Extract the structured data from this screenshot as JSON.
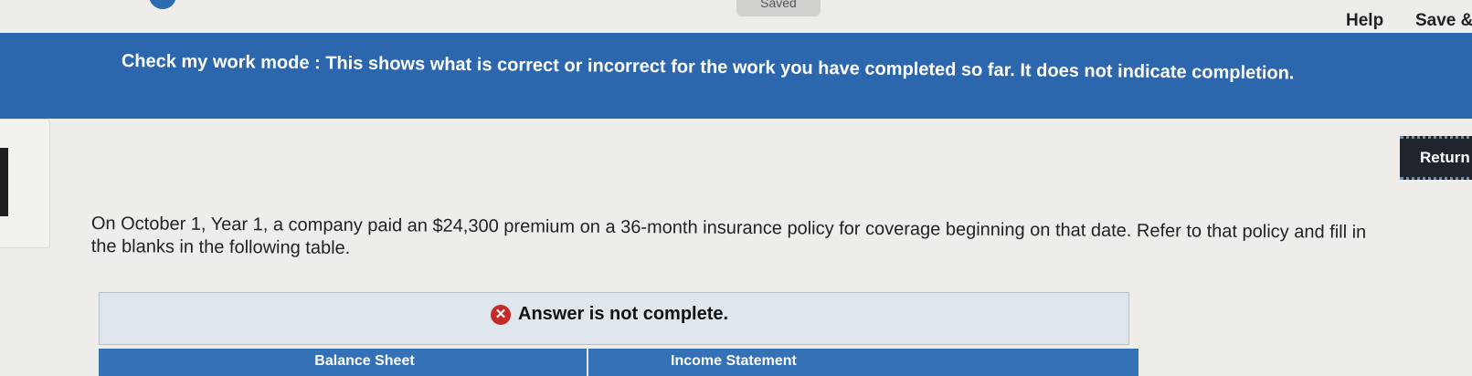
{
  "header": {
    "saved_label": "Saved",
    "help_label": "Help",
    "save_exit_label": "Save &"
  },
  "banner": {
    "text": "Check my work mode : This shows what is correct or incorrect for the work you have completed so far. It does not indicate completion."
  },
  "return_button": {
    "label": "Return"
  },
  "question": {
    "text": "On October 1, Year 1, a company paid an $24,300 premium on a 36-month insurance policy for coverage beginning on that date. Refer to that policy and fill in the blanks in the following table."
  },
  "answer_status": {
    "icon": "x-circle-icon",
    "label": "Answer is not complete.",
    "color": "#c52b2b"
  },
  "table": {
    "headers": [
      "Balance Sheet",
      "Income Statement"
    ]
  },
  "colors": {
    "banner": "#2c67ae",
    "table_header": "#3471b7",
    "page_background": "#efedea"
  }
}
